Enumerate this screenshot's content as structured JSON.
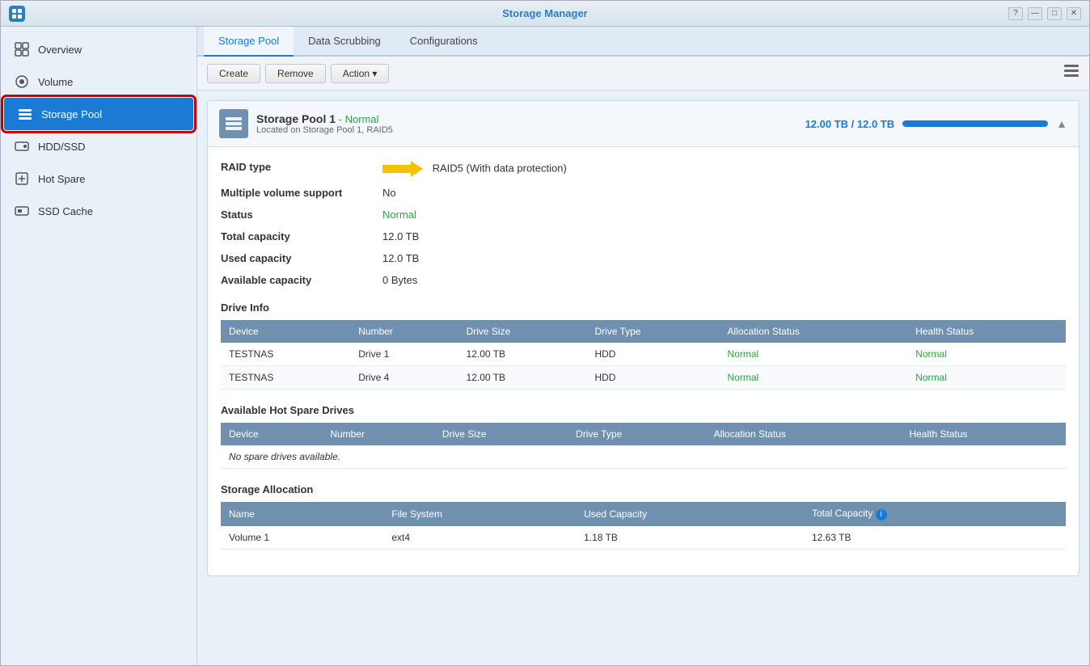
{
  "app": {
    "title": "Storage Manager",
    "icon": "📦"
  },
  "titlebar": {
    "controls": [
      "?",
      "—",
      "□",
      "✕"
    ]
  },
  "sidebar": {
    "items": [
      {
        "id": "overview",
        "label": "Overview",
        "icon": "overview"
      },
      {
        "id": "volume",
        "label": "Volume",
        "icon": "volume"
      },
      {
        "id": "storage-pool",
        "label": "Storage Pool",
        "icon": "storage-pool",
        "active": true
      },
      {
        "id": "hdd-ssd",
        "label": "HDD/SSD",
        "icon": "hdd-ssd"
      },
      {
        "id": "hot-spare",
        "label": "Hot Spare",
        "icon": "hot-spare"
      },
      {
        "id": "ssd-cache",
        "label": "SSD Cache",
        "icon": "ssd-cache"
      }
    ]
  },
  "tabs": [
    {
      "id": "storage-pool",
      "label": "Storage Pool",
      "active": true
    },
    {
      "id": "data-scrubbing",
      "label": "Data Scrubbing"
    },
    {
      "id": "configurations",
      "label": "Configurations"
    }
  ],
  "toolbar": {
    "create_label": "Create",
    "remove_label": "Remove",
    "action_label": "Action ▾"
  },
  "pool": {
    "title": "Storage Pool 1",
    "status_label": "- Normal",
    "subtitle": "Located on Storage Pool 1, RAID5",
    "capacity_text": "12.00 TB / 12.0  TB",
    "capacity_percent": 100,
    "fields": {
      "raid_type_label": "RAID type",
      "raid_type_value": "RAID5  (With data protection)",
      "multi_volume_label": "Multiple volume support",
      "multi_volume_value": "No",
      "status_label": "Status",
      "status_value": "Normal",
      "total_capacity_label": "Total capacity",
      "total_capacity_value": "12.0  TB",
      "used_capacity_label": "Used capacity",
      "used_capacity_value": "12.0  TB",
      "available_capacity_label": "Available capacity",
      "available_capacity_value": "0 Bytes"
    },
    "drive_info": {
      "section_title": "Drive Info",
      "columns": [
        "Device",
        "Number",
        "Drive Size",
        "Drive Type",
        "Allocation Status",
        "Health Status"
      ],
      "rows": [
        {
          "device": "TESTNAS",
          "number": "Drive 1",
          "size": "12.00 TB",
          "type": "HDD",
          "alloc_status": "Normal",
          "health_status": "Normal"
        },
        {
          "device": "TESTNAS",
          "number": "Drive 4",
          "size": "12.00 TB",
          "type": "HDD",
          "alloc_status": "Normal",
          "health_status": "Normal"
        }
      ]
    },
    "hot_spare": {
      "section_title": "Available Hot Spare Drives",
      "columns": [
        "Device",
        "Number",
        "Drive Size",
        "Drive Type",
        "Allocation Status",
        "Health Status"
      ],
      "empty_message": "No spare drives available."
    },
    "storage_allocation": {
      "section_title": "Storage Allocation",
      "columns": [
        "Name",
        "File System",
        "Used Capacity",
        "Total Capacity ℹ"
      ],
      "rows": [
        {
          "name": "Volume 1",
          "fs": "ext4",
          "used": "1.18 TB",
          "total": "12.63 TB"
        }
      ]
    }
  }
}
